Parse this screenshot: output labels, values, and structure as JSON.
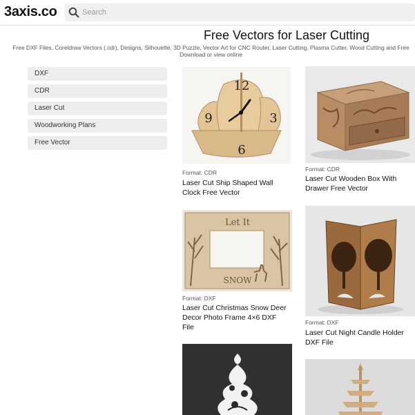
{
  "header": {
    "logo": "3axis.co",
    "search": {
      "placeholder": "Search",
      "value": ""
    }
  },
  "hero": {
    "title": "Free Vectors for Laser Cutting",
    "subtitle": "Free DXF Files, Coreldraw Vectors (.cdr), Designs, Silhouette, 3D Puzzle, Vector Art for CNC Router, Laser Cutting, Plasma Cutter, Wood Cutting and Free Download or view online"
  },
  "sidebar": {
    "categories": [
      {
        "label": "DXF"
      },
      {
        "label": "CDR"
      },
      {
        "label": "Laser Cut"
      },
      {
        "label": "Woodworking Plans"
      },
      {
        "label": "Free Vector"
      }
    ]
  },
  "cards": [
    {
      "format": "Format: CDR",
      "title": "Laser Cut Ship Shaped Wall Clock Free Vector",
      "image": "ship-clock-image"
    },
    {
      "format": "Format: CDR",
      "title": "Laser Cut Wooden Box With Drawer Free Vector",
      "image": "wooden-box-image"
    },
    {
      "format": "Format: DXF",
      "title": "Laser Cut Christmas Snow Deer Decor Photo Frame 4×6 DXF File",
      "image": "photo-frame-image"
    },
    {
      "format": "Format: DXF",
      "title": "Laser Cut Night Candle Holder DXF File",
      "image": "candle-holder-image"
    },
    {
      "format": "",
      "title": "",
      "image": "christmas-tree-ornament-image"
    },
    {
      "format": "",
      "title": "",
      "image": "wooden-tree-image"
    }
  ],
  "images": {
    "clock_numbers": [
      "12",
      "3",
      "6",
      "9"
    ],
    "frame_text_top": "Let It",
    "frame_text_bottom": "SNOW"
  }
}
